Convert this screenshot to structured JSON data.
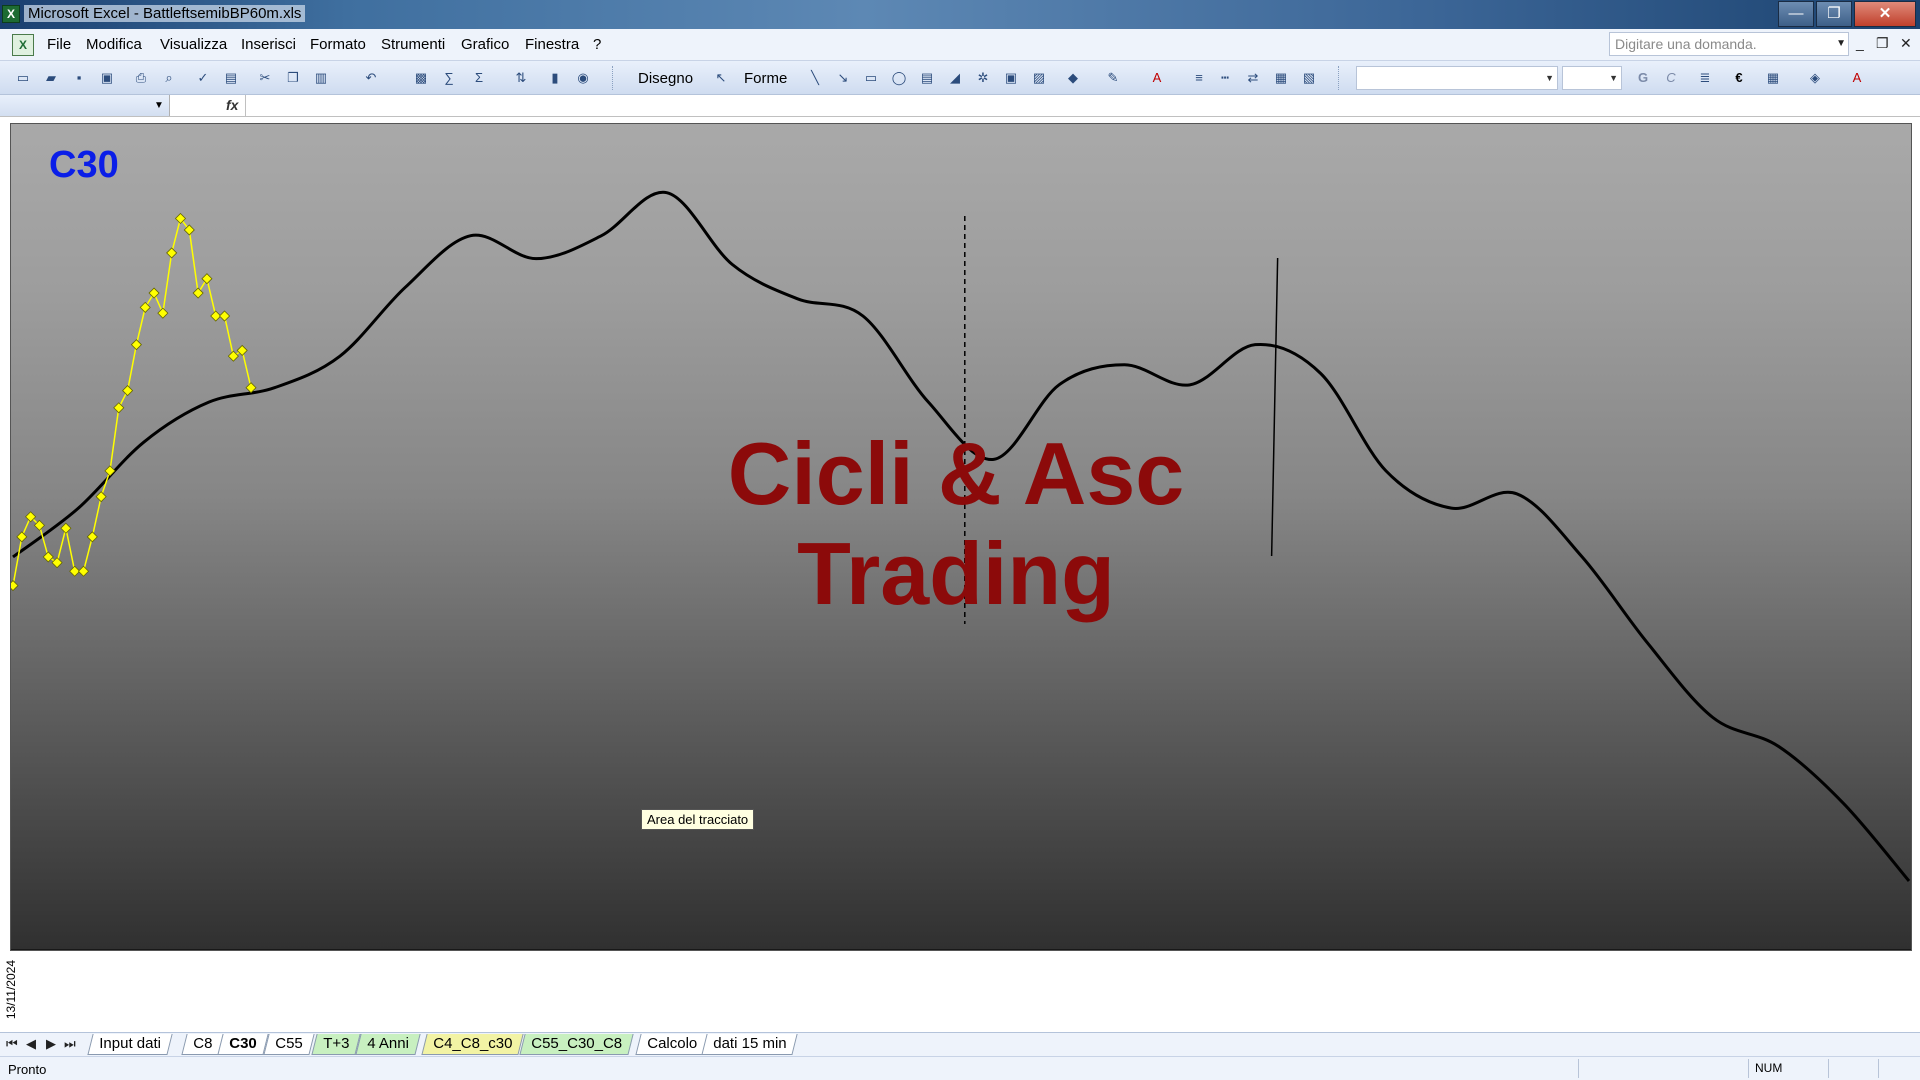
{
  "window": {
    "title": "Microsoft Excel - BattleftsemibBP60m.xls",
    "app_icon": "excel-icon",
    "controls": {
      "minimize": "—",
      "maximize": "❐",
      "close": "✕"
    }
  },
  "menu": {
    "items": [
      "File",
      "Modifica",
      "Visualizza",
      "Inserisci",
      "Formato",
      "Strumenti",
      "Grafico",
      "Finestra",
      "?"
    ],
    "ask_placeholder": "Digitare una domanda.",
    "mdi": {
      "minimize": "_",
      "restore": "❐",
      "close": "✕"
    }
  },
  "toolbar": {
    "drawing_label": "Disegno",
    "shapes_label": "Forme",
    "bold_label": "G",
    "italic_label": "C",
    "euro_label": "€"
  },
  "formula_bar": {
    "fx_label": "fx"
  },
  "chart": {
    "title": "C30",
    "watermark_line1": "Cicli & Asc",
    "watermark_line2": "Trading",
    "tooltip": "Area del tracciato",
    "x_label": "13/11/2024"
  },
  "chart_data": {
    "type": "line",
    "title": "C30",
    "grid": false,
    "series": [
      {
        "color": "#000000",
        "style": "smooth-line",
        "values": [
          -0.12,
          0.05,
          0.28,
          0.42,
          0.47,
          0.58,
          0.82,
          1.0,
          0.92,
          1.0,
          1.15,
          0.9,
          0.78,
          0.72,
          0.42,
          0.22,
          0.48,
          0.55,
          0.48,
          0.62,
          0.52,
          0.18,
          0.05,
          0.1,
          -0.12,
          -0.42,
          -0.68,
          -0.78,
          -0.98,
          -1.25
        ]
      },
      {
        "color": "#ffff00",
        "style": "line-diamond",
        "values": [
          -0.22,
          -0.05,
          0.02,
          -0.01,
          -0.12,
          -0.14,
          -0.02,
          -0.17,
          -0.17,
          -0.05,
          0.09,
          0.18,
          0.4,
          0.46,
          0.62,
          0.75,
          0.8,
          0.73,
          0.94,
          1.06,
          1.02,
          0.8,
          0.85,
          0.72,
          0.72,
          0.58,
          0.6,
          0.47
        ]
      }
    ],
    "markers": {
      "vertical_dashed_line_at": 0.502,
      "vertical_solid_line_at": 0.667
    }
  },
  "sheets": {
    "tabs": [
      {
        "label": "Input dati",
        "style": "plain"
      },
      {
        "label": "C8",
        "style": "plain"
      },
      {
        "label": "C30",
        "style": "active"
      },
      {
        "label": "C55",
        "style": "plain"
      },
      {
        "label": "T+3",
        "style": "green"
      },
      {
        "label": "4 Anni",
        "style": "green"
      },
      {
        "label": "C4_C8_c30",
        "style": "yellow"
      },
      {
        "label": "C55_C30_C8",
        "style": "green"
      },
      {
        "label": "Calcolo",
        "style": "plain"
      },
      {
        "label": "dati 15 min",
        "style": "plain"
      }
    ],
    "nav": {
      "first": "⏮",
      "prev": "◀",
      "next": "▶",
      "last": "⏭"
    }
  },
  "status": {
    "text": "Pronto",
    "num": "NUM"
  }
}
